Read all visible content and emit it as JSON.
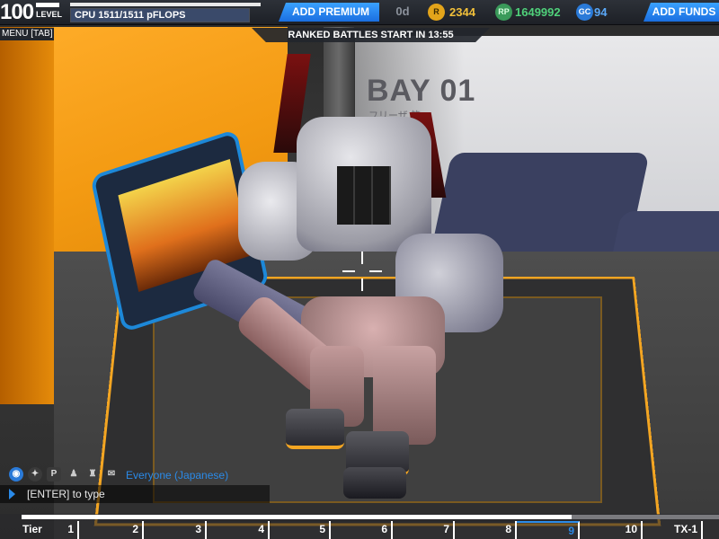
{
  "hud": {
    "level_number": "100",
    "level_label": "LEVEL",
    "cpu_text": "CPU  1511/1511 pFLOPS",
    "cpu_fraction": 1.0,
    "add_premium_label": "ADD PREMIUM",
    "premium_days": "0d",
    "robits_icon": "R",
    "robits_value": "2344",
    "rp_icon": "RP",
    "rp_value": "1649992",
    "gc_icon": "GC",
    "gc_value": "94",
    "add_funds_label": "ADD FUNDS",
    "menu_label": "MENU [TAB]",
    "ranked_banner": "RANKED BATTLES START IN 13:55"
  },
  "scene": {
    "bay_label": "BAY 01",
    "bay_sub": "フリーザ  第一"
  },
  "chat": {
    "channel_label": "Everyone (Japanese)",
    "input_placeholder": "[ENTER] to type",
    "icons": [
      "globe-icon",
      "people-icon",
      "party-icon",
      "friends-icon",
      "clan-icon",
      "whisper-icon"
    ]
  },
  "tier_bar": {
    "label": "Tier",
    "tiers": [
      "1",
      "2",
      "3",
      "4",
      "5",
      "6",
      "7",
      "8",
      "9",
      "10",
      "TX-1"
    ],
    "active_tier": "9"
  },
  "colors": {
    "accent_blue": "#2a8ae8",
    "robits_gold": "#f2c03a",
    "rp_green": "#4fd07a",
    "gc_blue": "#5aa8f8",
    "garage_orange": "#f3a522"
  }
}
